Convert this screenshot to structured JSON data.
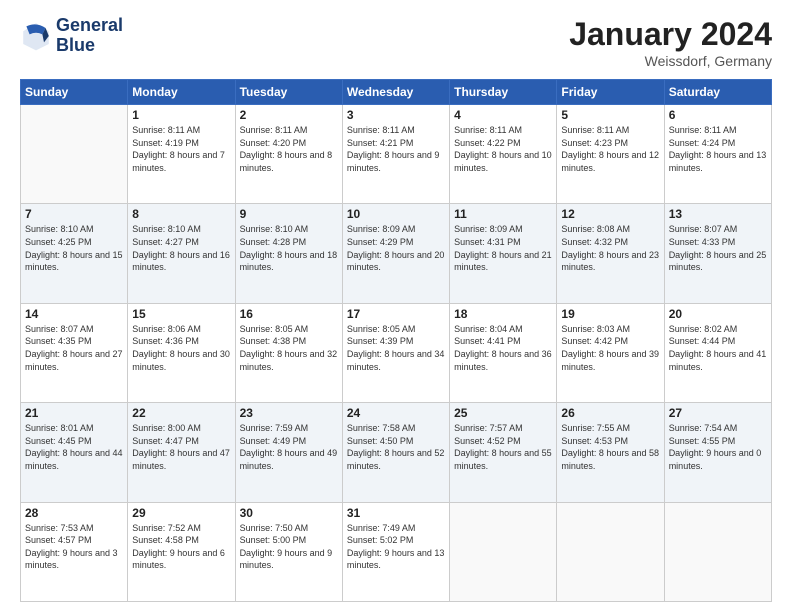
{
  "logo": {
    "line1": "General",
    "line2": "Blue"
  },
  "title": "January 2024",
  "subtitle": "Weissdorf, Germany",
  "days_of_week": [
    "Sunday",
    "Monday",
    "Tuesday",
    "Wednesday",
    "Thursday",
    "Friday",
    "Saturday"
  ],
  "weeks": [
    [
      {
        "day": "",
        "sunrise": "",
        "sunset": "",
        "daylight": ""
      },
      {
        "day": "1",
        "sunrise": "Sunrise: 8:11 AM",
        "sunset": "Sunset: 4:19 PM",
        "daylight": "Daylight: 8 hours and 7 minutes."
      },
      {
        "day": "2",
        "sunrise": "Sunrise: 8:11 AM",
        "sunset": "Sunset: 4:20 PM",
        "daylight": "Daylight: 8 hours and 8 minutes."
      },
      {
        "day": "3",
        "sunrise": "Sunrise: 8:11 AM",
        "sunset": "Sunset: 4:21 PM",
        "daylight": "Daylight: 8 hours and 9 minutes."
      },
      {
        "day": "4",
        "sunrise": "Sunrise: 8:11 AM",
        "sunset": "Sunset: 4:22 PM",
        "daylight": "Daylight: 8 hours and 10 minutes."
      },
      {
        "day": "5",
        "sunrise": "Sunrise: 8:11 AM",
        "sunset": "Sunset: 4:23 PM",
        "daylight": "Daylight: 8 hours and 12 minutes."
      },
      {
        "day": "6",
        "sunrise": "Sunrise: 8:11 AM",
        "sunset": "Sunset: 4:24 PM",
        "daylight": "Daylight: 8 hours and 13 minutes."
      }
    ],
    [
      {
        "day": "7",
        "sunrise": "Sunrise: 8:10 AM",
        "sunset": "Sunset: 4:25 PM",
        "daylight": "Daylight: 8 hours and 15 minutes."
      },
      {
        "day": "8",
        "sunrise": "Sunrise: 8:10 AM",
        "sunset": "Sunset: 4:27 PM",
        "daylight": "Daylight: 8 hours and 16 minutes."
      },
      {
        "day": "9",
        "sunrise": "Sunrise: 8:10 AM",
        "sunset": "Sunset: 4:28 PM",
        "daylight": "Daylight: 8 hours and 18 minutes."
      },
      {
        "day": "10",
        "sunrise": "Sunrise: 8:09 AM",
        "sunset": "Sunset: 4:29 PM",
        "daylight": "Daylight: 8 hours and 20 minutes."
      },
      {
        "day": "11",
        "sunrise": "Sunrise: 8:09 AM",
        "sunset": "Sunset: 4:31 PM",
        "daylight": "Daylight: 8 hours and 21 minutes."
      },
      {
        "day": "12",
        "sunrise": "Sunrise: 8:08 AM",
        "sunset": "Sunset: 4:32 PM",
        "daylight": "Daylight: 8 hours and 23 minutes."
      },
      {
        "day": "13",
        "sunrise": "Sunrise: 8:07 AM",
        "sunset": "Sunset: 4:33 PM",
        "daylight": "Daylight: 8 hours and 25 minutes."
      }
    ],
    [
      {
        "day": "14",
        "sunrise": "Sunrise: 8:07 AM",
        "sunset": "Sunset: 4:35 PM",
        "daylight": "Daylight: 8 hours and 27 minutes."
      },
      {
        "day": "15",
        "sunrise": "Sunrise: 8:06 AM",
        "sunset": "Sunset: 4:36 PM",
        "daylight": "Daylight: 8 hours and 30 minutes."
      },
      {
        "day": "16",
        "sunrise": "Sunrise: 8:05 AM",
        "sunset": "Sunset: 4:38 PM",
        "daylight": "Daylight: 8 hours and 32 minutes."
      },
      {
        "day": "17",
        "sunrise": "Sunrise: 8:05 AM",
        "sunset": "Sunset: 4:39 PM",
        "daylight": "Daylight: 8 hours and 34 minutes."
      },
      {
        "day": "18",
        "sunrise": "Sunrise: 8:04 AM",
        "sunset": "Sunset: 4:41 PM",
        "daylight": "Daylight: 8 hours and 36 minutes."
      },
      {
        "day": "19",
        "sunrise": "Sunrise: 8:03 AM",
        "sunset": "Sunset: 4:42 PM",
        "daylight": "Daylight: 8 hours and 39 minutes."
      },
      {
        "day": "20",
        "sunrise": "Sunrise: 8:02 AM",
        "sunset": "Sunset: 4:44 PM",
        "daylight": "Daylight: 8 hours and 41 minutes."
      }
    ],
    [
      {
        "day": "21",
        "sunrise": "Sunrise: 8:01 AM",
        "sunset": "Sunset: 4:45 PM",
        "daylight": "Daylight: 8 hours and 44 minutes."
      },
      {
        "day": "22",
        "sunrise": "Sunrise: 8:00 AM",
        "sunset": "Sunset: 4:47 PM",
        "daylight": "Daylight: 8 hours and 47 minutes."
      },
      {
        "day": "23",
        "sunrise": "Sunrise: 7:59 AM",
        "sunset": "Sunset: 4:49 PM",
        "daylight": "Daylight: 8 hours and 49 minutes."
      },
      {
        "day": "24",
        "sunrise": "Sunrise: 7:58 AM",
        "sunset": "Sunset: 4:50 PM",
        "daylight": "Daylight: 8 hours and 52 minutes."
      },
      {
        "day": "25",
        "sunrise": "Sunrise: 7:57 AM",
        "sunset": "Sunset: 4:52 PM",
        "daylight": "Daylight: 8 hours and 55 minutes."
      },
      {
        "day": "26",
        "sunrise": "Sunrise: 7:55 AM",
        "sunset": "Sunset: 4:53 PM",
        "daylight": "Daylight: 8 hours and 58 minutes."
      },
      {
        "day": "27",
        "sunrise": "Sunrise: 7:54 AM",
        "sunset": "Sunset: 4:55 PM",
        "daylight": "Daylight: 9 hours and 0 minutes."
      }
    ],
    [
      {
        "day": "28",
        "sunrise": "Sunrise: 7:53 AM",
        "sunset": "Sunset: 4:57 PM",
        "daylight": "Daylight: 9 hours and 3 minutes."
      },
      {
        "day": "29",
        "sunrise": "Sunrise: 7:52 AM",
        "sunset": "Sunset: 4:58 PM",
        "daylight": "Daylight: 9 hours and 6 minutes."
      },
      {
        "day": "30",
        "sunrise": "Sunrise: 7:50 AM",
        "sunset": "Sunset: 5:00 PM",
        "daylight": "Daylight: 9 hours and 9 minutes."
      },
      {
        "day": "31",
        "sunrise": "Sunrise: 7:49 AM",
        "sunset": "Sunset: 5:02 PM",
        "daylight": "Daylight: 9 hours and 13 minutes."
      },
      {
        "day": "",
        "sunrise": "",
        "sunset": "",
        "daylight": ""
      },
      {
        "day": "",
        "sunrise": "",
        "sunset": "",
        "daylight": ""
      },
      {
        "day": "",
        "sunrise": "",
        "sunset": "",
        "daylight": ""
      }
    ]
  ]
}
